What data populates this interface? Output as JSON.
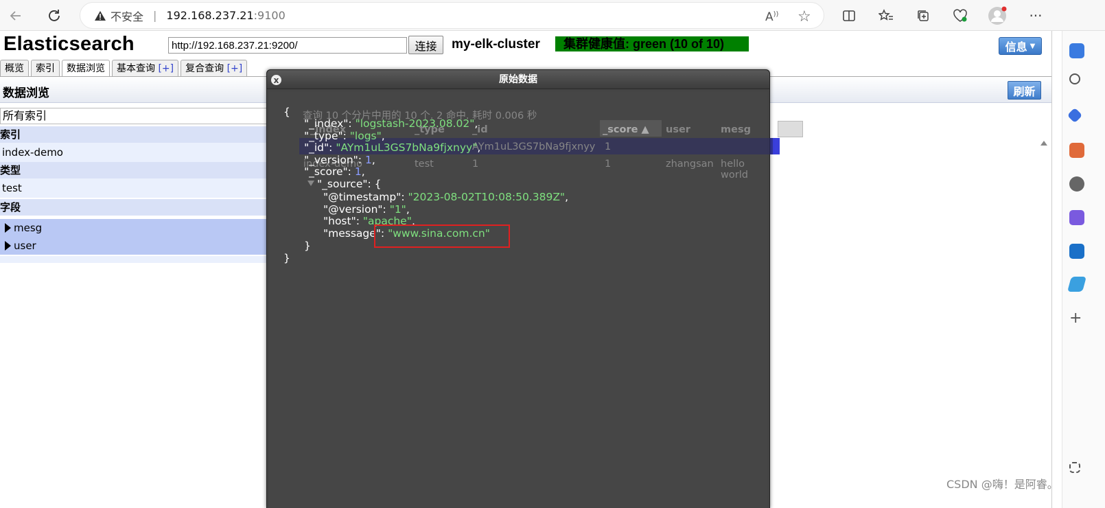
{
  "browser": {
    "security_label": "不安全",
    "address_host": "192.168.237.21",
    "address_port": ":9100"
  },
  "app": {
    "brand": "Elasticsearch",
    "url_value": "http://192.168.237.21:9200/",
    "connect_label": "连接",
    "cluster_name": "my-elk-cluster",
    "health_text": "集群健康值: green (10 of 10)",
    "health_color": "#008000",
    "info_label": "信息",
    "refresh_label": "刷新",
    "section_title": "数据浏览"
  },
  "tabs": [
    {
      "label": "概览",
      "plus": ""
    },
    {
      "label": "索引",
      "plus": ""
    },
    {
      "label": "数据浏览",
      "plus": ""
    },
    {
      "label": "基本查询 ",
      "plus": "[+]"
    },
    {
      "label": "复合查询 ",
      "plus": "[+]"
    }
  ],
  "filter": {
    "index_select": "所有索引",
    "index_header": "索引",
    "index_value": "index-demo",
    "type_header": "类型",
    "type_value": "test",
    "field_header": "字段",
    "fields": [
      "mesg",
      "user"
    ]
  },
  "results": {
    "summary": "查询 10 个分片中用的 10 个. 2 命中. 耗时 0.006 秒",
    "columns": [
      "_index",
      "_type",
      "_id",
      "_score ▲",
      "user",
      "mesg"
    ],
    "row1": {
      "id": "AYm1uL3GS7bNa9fjxnyy",
      "score": "1"
    },
    "row2": {
      "index": "index-demo",
      "type": "test",
      "id": "1",
      "score": "1",
      "user": "zhangsan",
      "mesg": "hello world"
    }
  },
  "modal": {
    "title": "原始数据",
    "close": "x",
    "lines": {
      "open": "{",
      "index_k": "\"_index\": ",
      "index_v": "\"logstash-2023.08.02\"",
      "type_k": "\"_type\": ",
      "type_v": "\"logs\"",
      "id_k": "\"_id\": ",
      "id_v": "\"AYm1uL3GS7bNa9fjxnyy\"",
      "version_k": "\"_version\": ",
      "version_v": "1",
      "score_k": "\"_score\": ",
      "score_v": "1",
      "source_k": "\"_source\": {",
      "ts_k": "\"@timestamp\": ",
      "ts_v": "\"2023-08-02T10:08:50.389Z\"",
      "ver_k": "\"@version\": ",
      "ver_v": "\"1\"",
      "host_k": "\"host\": ",
      "host_v": "\"apache\"",
      "msg_k": "\"message\": ",
      "msg_v": "\"www.sina.com.cn\"",
      "inner_close": "}",
      "close": "}"
    }
  },
  "watermark": "CSDN @嗨！是阿睿。"
}
